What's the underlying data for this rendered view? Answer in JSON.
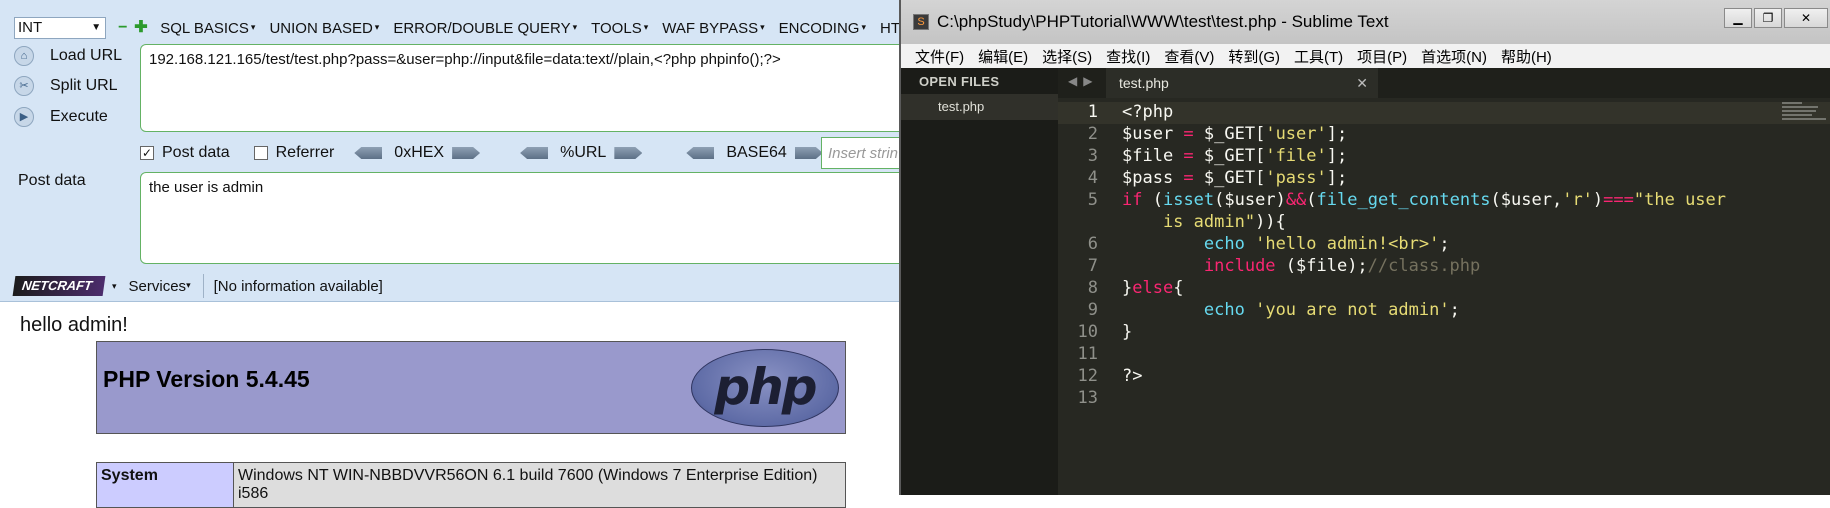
{
  "hackbar": {
    "int_select": "INT",
    "menu": [
      "SQL BASICS",
      "UNION BASED",
      "ERROR/DOUBLE QUERY",
      "TOOLS",
      "WAF BYPASS",
      "ENCODING",
      "HT"
    ],
    "load_url": "Load URL",
    "split_url": "Split URL",
    "execute": "Execute",
    "url_value": "192.168.121.165/test/test.php?pass=&user=php://input&file=data:text//plain,<?php phpinfo();?>",
    "post_data_checkbox": "Post data",
    "referrer_checkbox": "Referrer",
    "hex": "0xHEX",
    "url_enc": "%URL",
    "base64": "BASE64",
    "insert_placeholder": "Insert strin",
    "post_label": "Post data",
    "post_value": "the user is admin"
  },
  "netcraft": {
    "logo": "NETCRAFT",
    "services": "Services",
    "info": "[No information available]"
  },
  "page": {
    "hello": "hello admin!",
    "php_version": "PHP Version 5.4.45",
    "php_logo": "php",
    "system_label": "System",
    "system_value": "Windows NT WIN-NBBDVVR56ON 6.1 build 7600 (Windows 7 Enterprise Edition) i586"
  },
  "sublime": {
    "title": "C:\\phpStudy\\PHPTutorial\\WWW\\test\\test.php - Sublime Text",
    "menu": [
      "文件(F)",
      "编辑(E)",
      "选择(S)",
      "查找(I)",
      "查看(V)",
      "转到(G)",
      "工具(T)",
      "项目(P)",
      "首选项(N)",
      "帮助(H)"
    ],
    "open_files": "OPEN FILES",
    "sidebar_file": "test.php",
    "tab_name": "test.php",
    "line_numbers": [
      "1",
      "2",
      "3",
      "4",
      "5",
      "",
      "6",
      "7",
      "8",
      "9",
      "10",
      "11",
      "12",
      "13"
    ]
  },
  "colors": {
    "hackbar_bg": "#d6e5f5",
    "sublime_bg": "#272822",
    "keyword": "#f92672",
    "function": "#66d9ef",
    "string": "#e6db74",
    "comment": "#75715e",
    "php_banner": "#9999cc"
  }
}
